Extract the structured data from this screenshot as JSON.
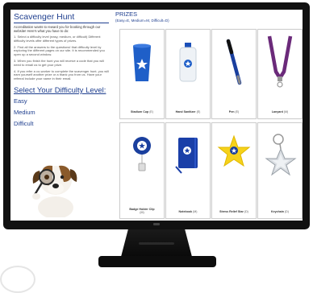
{
  "left": {
    "title": "Scavenger Hunt",
    "intro": "Accreditation wants to reward you for booking through our website! Here's what you have to do:",
    "steps": [
      "1. Select a difficulty level (easy, medium, or difficult) Different difficulty levels offer different types of prizes.",
      "2. Find all the answers to the questions! that difficulty level by exploring the different pages on our site. It is recommended you open up a second window.",
      "3. When you finish the hunt you will receive a code that you will need to email us to get your prize.",
      "4. If you refer a co-worker to complete the scavenger hunt, you will earn yourself another prize or a thank you from us. Have your referral include your name in their email."
    ],
    "difficulty_title": "Select Your Difficulty Level:",
    "difficulties": [
      "Easy",
      "Medium",
      "Difficult"
    ]
  },
  "right": {
    "title": "PRIZES",
    "subtitle": "(Easy=E, Medium=M, Difficult=D)",
    "prizes": [
      {
        "name": "Stadium Cup",
        "tier": "(E)"
      },
      {
        "name": "Hand Sanitizer",
        "tier": "(E)"
      },
      {
        "name": "Pen",
        "tier": "(E)"
      },
      {
        "name": "Lanyard",
        "tier": "(M)"
      },
      {
        "name": "Badge Holder Clip",
        "tier": "(M)"
      },
      {
        "name": "Notebook",
        "tier": "(M)"
      },
      {
        "name": "Stress Relief Star",
        "tier": "(D)"
      },
      {
        "name": "Keychain",
        "tier": "(D)"
      }
    ]
  },
  "colors": {
    "brand_blue": "#1f3f8f",
    "bezel": "#111111",
    "star_yellow": "#f6d21a"
  }
}
